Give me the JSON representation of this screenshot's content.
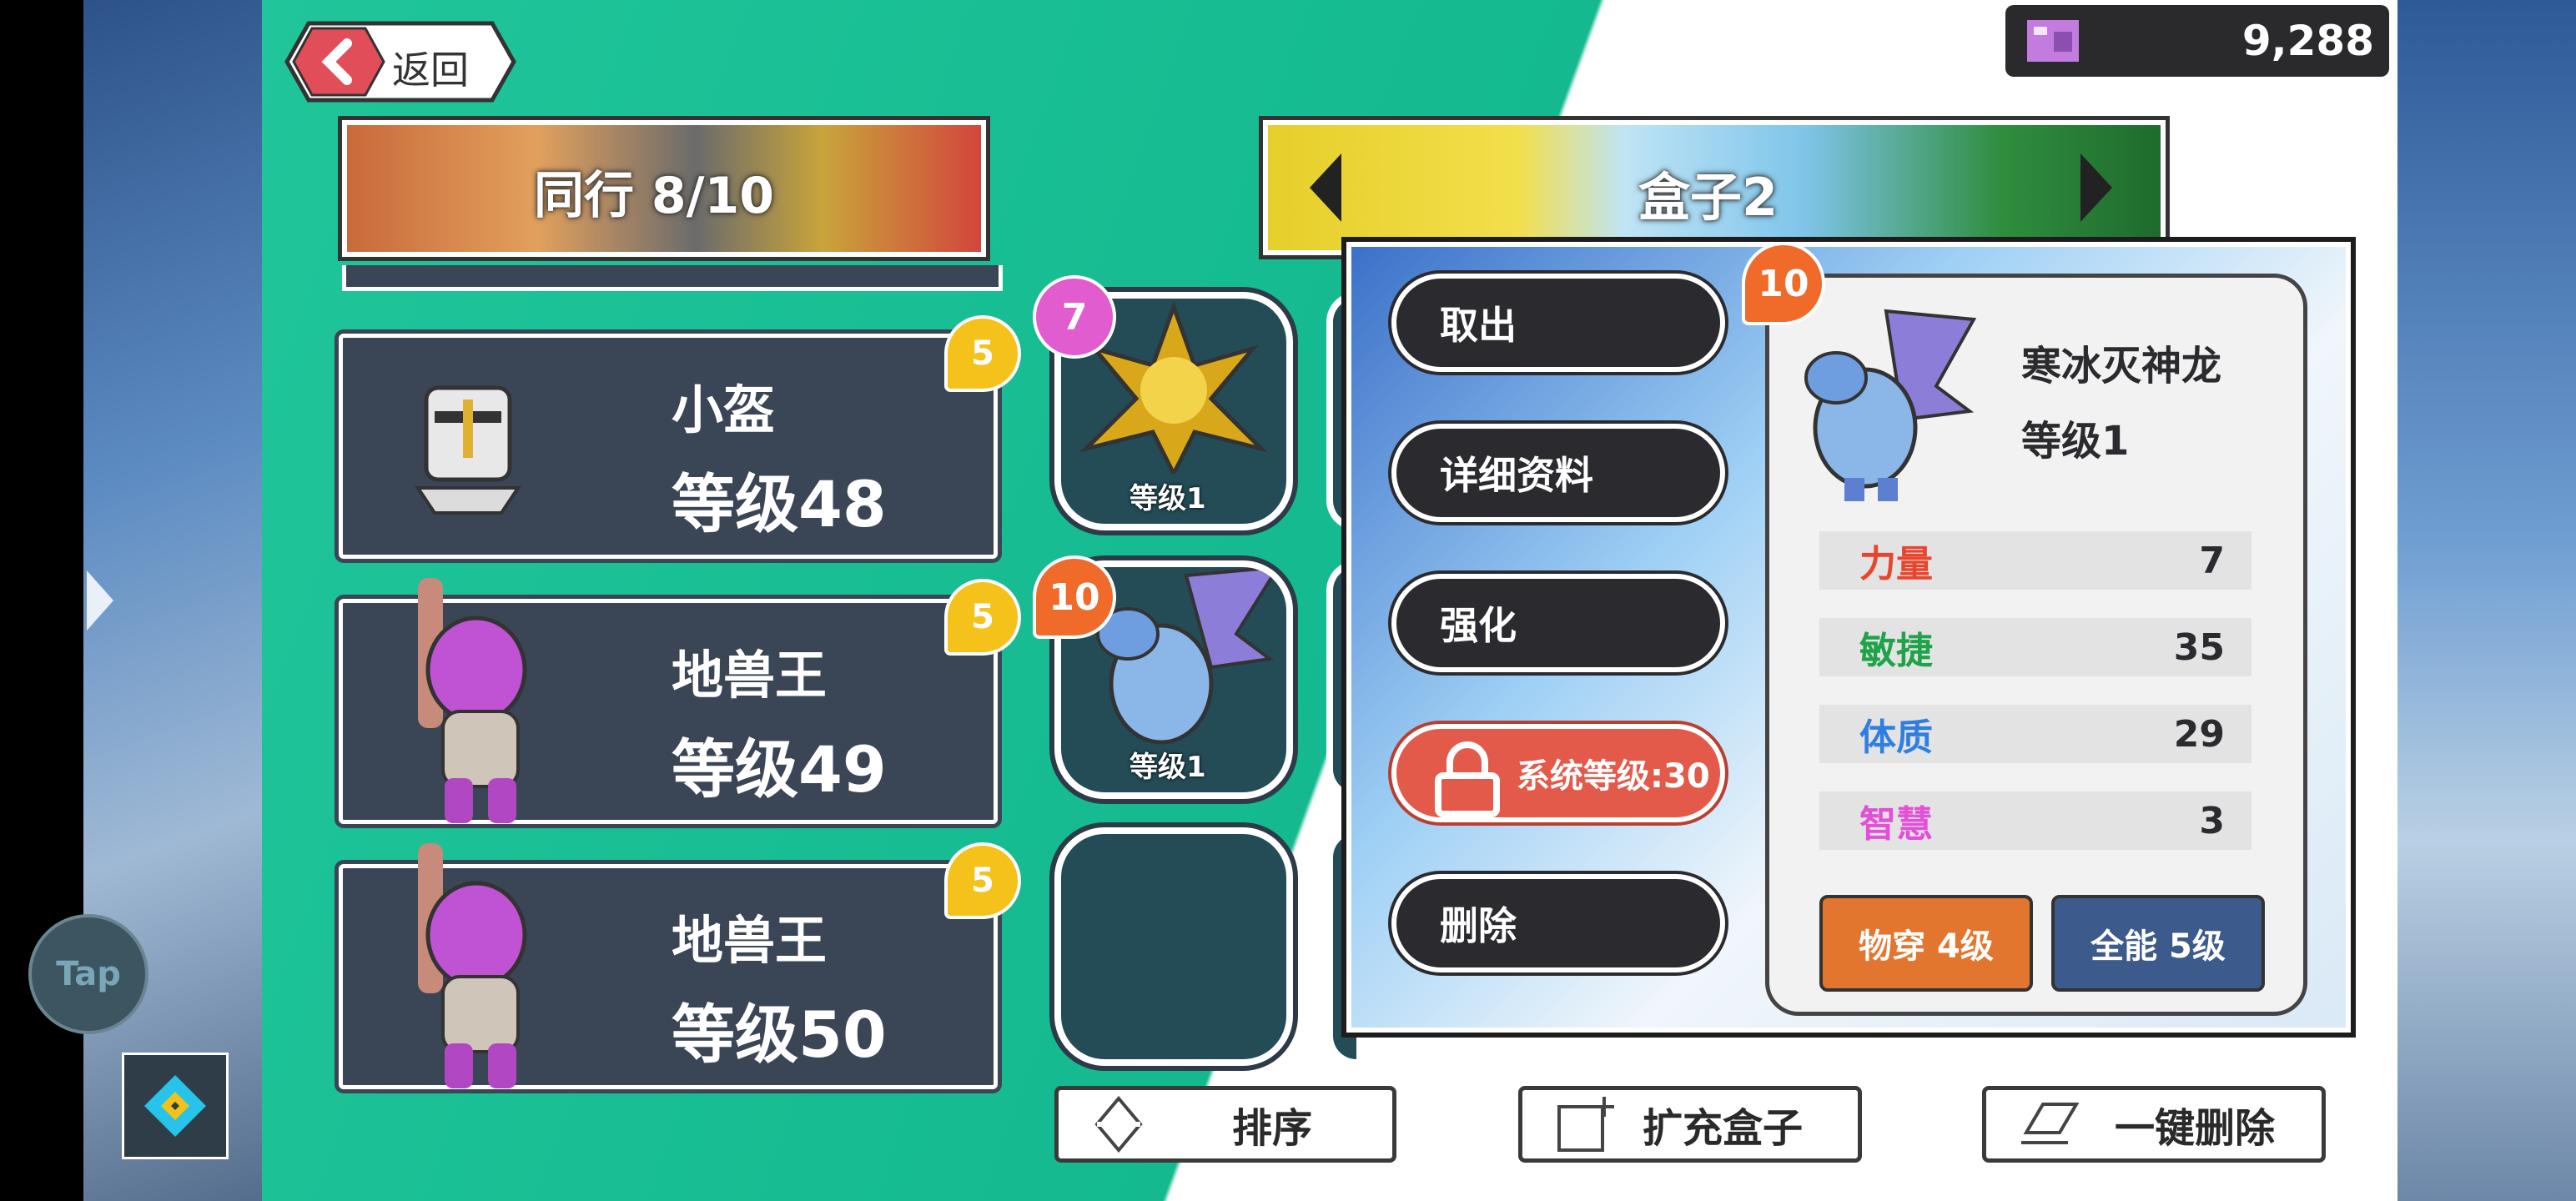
{
  "header": {
    "back_label": "返回",
    "currency_value": "9,288"
  },
  "party_banner": {
    "label": "同行 8/10"
  },
  "box_banner": {
    "label": "盒子2"
  },
  "party": [
    {
      "name": "小盔",
      "level": "等级48",
      "badge": "5"
    },
    {
      "name": "地兽王",
      "level": "等级49",
      "badge": "5"
    },
    {
      "name": "地兽王",
      "level": "等级50",
      "badge": "5"
    }
  ],
  "box_slots": [
    {
      "badge": "7",
      "level": "等级1"
    },
    {
      "badge": "10",
      "level": "等级1"
    }
  ],
  "menu": {
    "take_out": "取出",
    "details": "详细资料",
    "enhance": "强化",
    "locked": "系统等级:30",
    "delete": "删除"
  },
  "detail": {
    "badge": "10",
    "name": "寒冰灭神龙",
    "level": "等级1",
    "stats": [
      {
        "label": "力量",
        "value": "7",
        "color": "#e8452e"
      },
      {
        "label": "敏捷",
        "value": "35",
        "color": "#1fa34a"
      },
      {
        "label": "体质",
        "value": "29",
        "color": "#2f7fe0"
      },
      {
        "label": "智慧",
        "value": "3",
        "color": "#e34fd6"
      }
    ],
    "skill_1": "物穿 4级",
    "skill_2": "全能 5级"
  },
  "bottom": {
    "sort": "排序",
    "expand": "扩充盒子",
    "bulk_delete": "一键删除"
  },
  "tap_label": "Tap",
  "colors": {
    "teal": "#14b98f",
    "orange_badge": "#f06b2a",
    "yellow_badge": "#f4c21a",
    "lock_red": "#e35a4a"
  }
}
